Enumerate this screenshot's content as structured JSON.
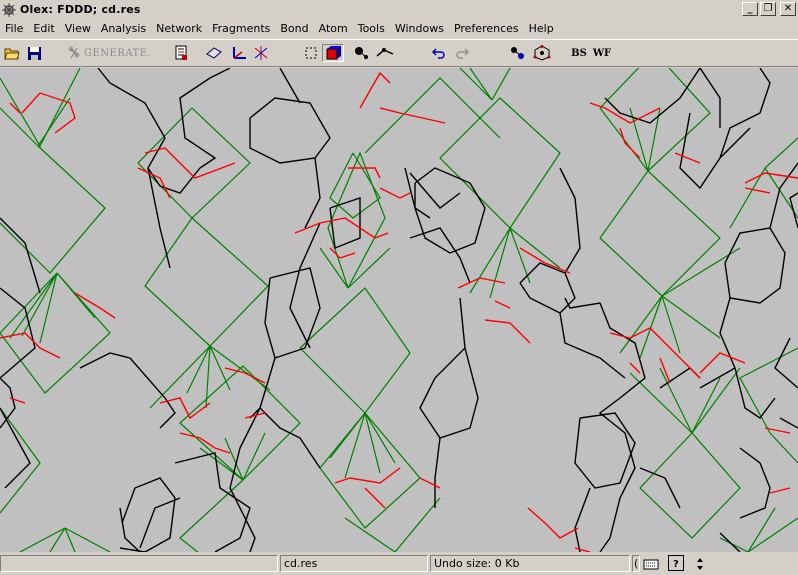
{
  "window": {
    "title": "Olex:  FDDD; cd.res",
    "minimize_label": "_",
    "restore_label": "❐",
    "close_label": "✕"
  },
  "menu": {
    "items": [
      "File",
      "Edit",
      "View",
      "Analysis",
      "Network",
      "Fragments",
      "Bond",
      "Atom",
      "Tools",
      "Windows",
      "Preferences",
      "Help"
    ]
  },
  "toolbar": {
    "generate_label": "GENERATE.",
    "bs_label": "BS",
    "wf_label": "WF",
    "icons": [
      "open-folder-icon",
      "save-icon",
      "generate-icon",
      "cell-icon",
      "plane-icon",
      "axes-icon",
      "axis-cross-icon",
      "select-box-icon",
      "color-cube-icon",
      "atom-tool-icon",
      "bond-tool-icon",
      "undo-icon",
      "redo-icon",
      "atom-label-icon",
      "molecule-icon"
    ]
  },
  "colors": {
    "background": "#c0c0c0",
    "black_bonds": "#000000",
    "green_bonds": "#008000",
    "red_bonds": "#ff0000"
  },
  "statusbar": {
    "panel1": "",
    "file_name": "cd.res",
    "undo_size": "Undo size: 0 Kb",
    "small_panel": "("
  }
}
